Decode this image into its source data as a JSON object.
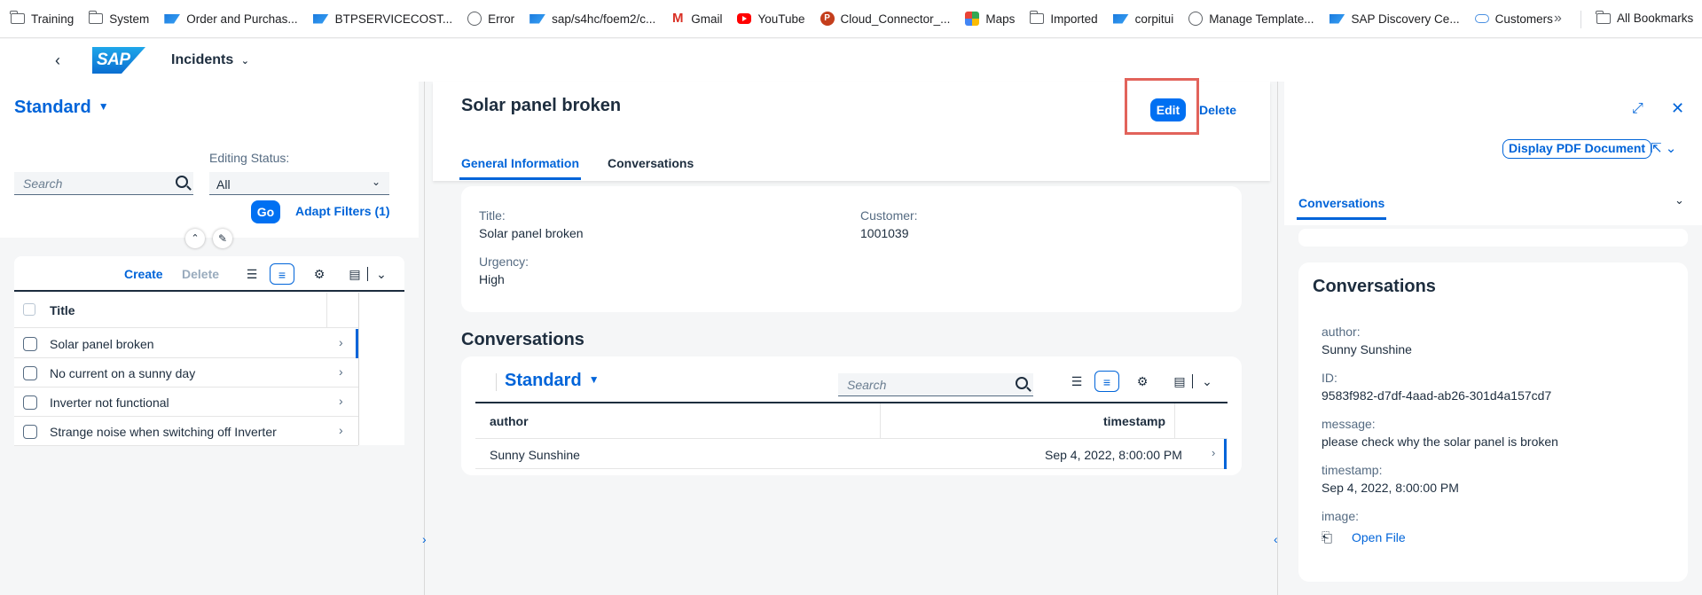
{
  "bookmarks": [
    {
      "label": "Training",
      "icon": "folder-icon"
    },
    {
      "label": "System",
      "icon": "folder-icon"
    },
    {
      "label": "Order and Purchas...",
      "icon": "sap-icon"
    },
    {
      "label": "BTPSERVICECOST...",
      "icon": "sap-icon"
    },
    {
      "label": "Error",
      "icon": "globe-icon"
    },
    {
      "label": "sap/s4hc/foem2/c...",
      "icon": "sap-icon"
    },
    {
      "label": "Gmail",
      "icon": "gmail-icon"
    },
    {
      "label": "YouTube",
      "icon": "youtube-icon"
    },
    {
      "label": "Cloud_Connector_...",
      "icon": "powerpoint-icon"
    },
    {
      "label": "Maps",
      "icon": "maps-icon"
    },
    {
      "label": "Imported",
      "icon": "folder-icon"
    },
    {
      "label": "corpitui",
      "icon": "sap-icon"
    },
    {
      "label": "Manage Template...",
      "icon": "globe-icon"
    },
    {
      "label": "SAP Discovery Ce...",
      "icon": "sap-icon"
    },
    {
      "label": "Customers",
      "icon": "cloud-icon"
    }
  ],
  "bookmarks_more": "»",
  "all_bookmarks": "All Bookmarks",
  "shell": {
    "logo": "SAP",
    "app_title": "Incidents"
  },
  "filter": {
    "variant": "Standard",
    "search_placeholder": "Search",
    "editing_status_label": "Editing Status:",
    "editing_status_value": "All",
    "go_label": "Go",
    "adapt_filters_label": "Adapt Filters (1)"
  },
  "list_toolbar": {
    "create": "Create",
    "delete": "Delete"
  },
  "list_table": {
    "header": "Title",
    "rows": [
      {
        "title": "Solar panel broken"
      },
      {
        "title": "No current on a sunny day"
      },
      {
        "title": "Inverter not functional"
      },
      {
        "title": "Strange noise when switching off Inverter"
      }
    ]
  },
  "object": {
    "title": "Solar panel broken",
    "edit_label": "Edit",
    "delete_label": "Delete",
    "tabs": [
      "General Information",
      "Conversations"
    ],
    "fields": {
      "title_label": "Title:",
      "title_value": "Solar panel broken",
      "customer_label": "Customer:",
      "customer_value": "1001039",
      "urgency_label": "Urgency:",
      "urgency_value": "High"
    },
    "conversations_title": "Conversations",
    "conversations_variant": "Standard",
    "conversations_search_placeholder": "Search",
    "conversations_columns": [
      "author",
      "timestamp"
    ],
    "conversations_rows": [
      {
        "author": "Sunny Sunshine",
        "timestamp": "Sep 4, 2022, 8:00:00 PM"
      }
    ]
  },
  "detail": {
    "pdf_button": "Display PDF Document",
    "tab": "Conversations",
    "card_title": "Conversations",
    "author_label": "author:",
    "author_value": "Sunny Sunshine",
    "id_label": "ID:",
    "id_value": "9583f982-d7df-4aad-ab26-301d4a157cd7",
    "message_label": "message:",
    "message_value": "please check why the solar panel is broken",
    "timestamp_label": "timestamp:",
    "timestamp_value": "Sep 4, 2022, 8:00:00 PM",
    "image_label": "image:",
    "open_file": "Open File"
  },
  "colors": {
    "accent": "#0064d9",
    "button": "#0070f2",
    "highlight": "#e2635b"
  }
}
